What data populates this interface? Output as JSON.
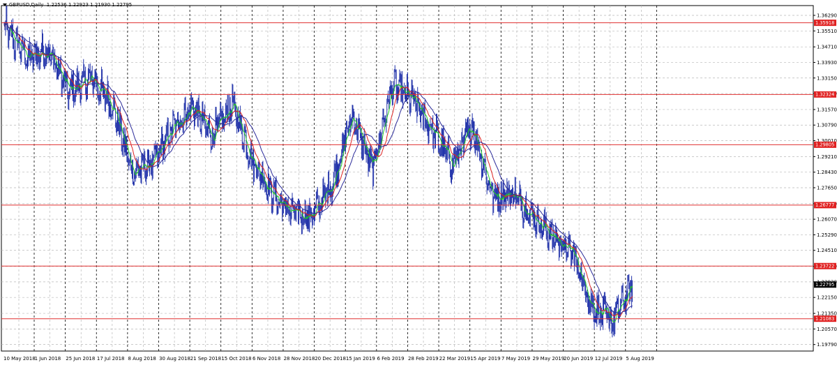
{
  "chart_header": {
    "symbol": "GBPUSD,Daily",
    "ohlc": "1.22536 1.22923 1.21930 1.22795"
  },
  "chart_data": {
    "type": "line",
    "title": "GBPUSD,Daily",
    "ylim": [
      1.1975,
      1.2965
    ],
    "grid": true,
    "y_ticks": [
      "1.36290",
      "1.35510",
      "1.34710",
      "1.33930",
      "1.33150",
      "1.32370",
      "1.31570",
      "1.30790",
      "1.30010",
      "1.29210",
      "1.28430",
      "1.27650",
      "1.26850",
      "1.26070",
      "1.25290",
      "1.24510",
      "1.23710",
      "1.22930",
      "1.22150",
      "1.21350",
      "1.20570",
      "1.19790"
    ],
    "y_tick_values": [
      1.3629,
      1.3551,
      1.3471,
      1.3393,
      1.3315,
      1.3237,
      1.3157,
      1.3079,
      1.3001,
      1.2921,
      1.2843,
      1.2765,
      1.2685,
      1.2607,
      1.2529,
      1.2451,
      1.2371,
      1.2293,
      1.2215,
      1.2135,
      1.2057,
      1.1979
    ],
    "x_labels": [
      "10 May 2018",
      "1 Jun 2018",
      "25 Jun 2018",
      "17 Jul 2018",
      "8 Aug 2018",
      "30 Aug 2018",
      "21 Sep 2018",
      "15 Oct 2018",
      "6 Nov 2018",
      "28 Nov 2018",
      "20 Dec 2018",
      "15 Jan 2019",
      "6 Feb 2019",
      "28 Feb 2019",
      "22 Mar 2019",
      "15 Apr 2019",
      "7 May 2019",
      "29 May 2019",
      "20 Jun 2019",
      "12 Jul 2019",
      "5 Aug 2019"
    ],
    "levels": [
      {
        "label": "1.35918",
        "value": 1.35918
      },
      {
        "label": "1.32324",
        "value": 1.32324
      },
      {
        "label": "1.29805",
        "value": 1.29805
      },
      {
        "label": "1.26777",
        "value": 1.26777
      },
      {
        "label": "1.23722",
        "value": 1.23722
      },
      {
        "label": "1.21083",
        "value": 1.21083
      }
    ],
    "current_price": {
      "label": "1.22795",
      "value": 1.22795
    },
    "anchors": [
      [
        0,
        1.3566
      ],
      [
        6,
        1.3418
      ],
      [
        11,
        1.3455
      ],
      [
        16,
        1.3252
      ],
      [
        22,
        1.3309
      ],
      [
        27,
        1.3183
      ],
      [
        32,
        1.2845
      ],
      [
        37,
        1.2885
      ],
      [
        42,
        1.3058
      ],
      [
        47,
        1.3173
      ],
      [
        52,
        1.3021
      ],
      [
        57,
        1.3184
      ],
      [
        62,
        1.2905
      ],
      [
        67,
        1.2732
      ],
      [
        72,
        1.2634
      ],
      [
        77,
        1.2628
      ],
      [
        82,
        1.279
      ],
      [
        87,
        1.3131
      ],
      [
        92,
        1.2856
      ],
      [
        97,
        1.3278
      ],
      [
        102,
        1.3205
      ],
      [
        107,
        1.3052
      ],
      [
        112,
        1.2883
      ],
      [
        117,
        1.3073
      ],
      [
        122,
        1.2725
      ],
      [
        127,
        1.2738
      ],
      [
        132,
        1.263
      ],
      [
        137,
        1.2521
      ],
      [
        142,
        1.244
      ],
      [
        147,
        1.2168
      ],
      [
        152,
        1.2095
      ],
      [
        157,
        1.228
      ]
    ],
    "series": [
      {
        "color": "#2233aa"
      },
      {
        "color": "#22cc22"
      },
      {
        "color": "#dd2222"
      },
      {
        "color": "#2a2a99"
      }
    ]
  },
  "colors": {
    "grid": "#b8b8b8",
    "separator": "#000000",
    "level_line": "#e03030",
    "level_label_bg": "#e02020",
    "current_label_bg": "#000000"
  }
}
